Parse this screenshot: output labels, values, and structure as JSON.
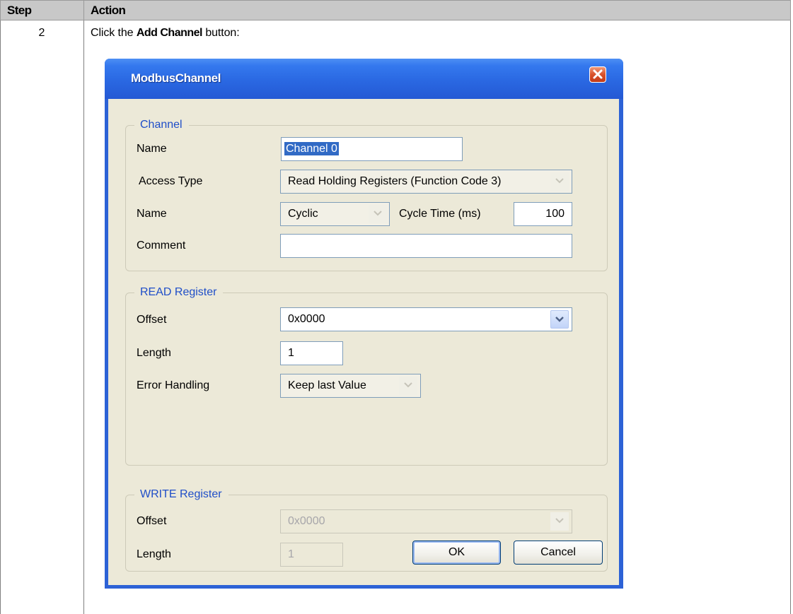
{
  "table": {
    "header_step": "Step",
    "header_action": "Action",
    "step_number": "2",
    "instruction_prefix": "Click the ",
    "instruction_bold": "Add Channel",
    "instruction_suffix": " button:"
  },
  "dialog": {
    "title": "ModbusChannel",
    "channel_group": {
      "legend": "Channel",
      "name_label": "Name",
      "name_value": "Channel 0",
      "access_type_label": "Access Type",
      "access_type_value": "Read Holding Registers (Function Code 3)",
      "trigger_label": "Name",
      "trigger_value": "Cyclic",
      "cycle_time_label": "Cycle Time (ms)",
      "cycle_time_value": "100",
      "comment_label": "Comment",
      "comment_value": ""
    },
    "read_group": {
      "legend": "READ Register",
      "offset_label": "Offset",
      "offset_value": "0x0000",
      "length_label": "Length",
      "length_value": "1",
      "error_handling_label": "Error Handling",
      "error_handling_value": "Keep last Value"
    },
    "write_group": {
      "legend": "WRITE Register",
      "offset_label": "Offset",
      "offset_value": "0x0000",
      "length_label": "Length",
      "length_value": "1"
    },
    "ok_label": "OK",
    "cancel_label": "Cancel"
  },
  "icons": {
    "close": "close-icon",
    "dropdown": "chevron-down-icon"
  },
  "colors": {
    "titlebar": "#2a68e2",
    "legend_text": "#1f4ec8",
    "selection": "#316ac5",
    "close_button": "#d8512a"
  }
}
